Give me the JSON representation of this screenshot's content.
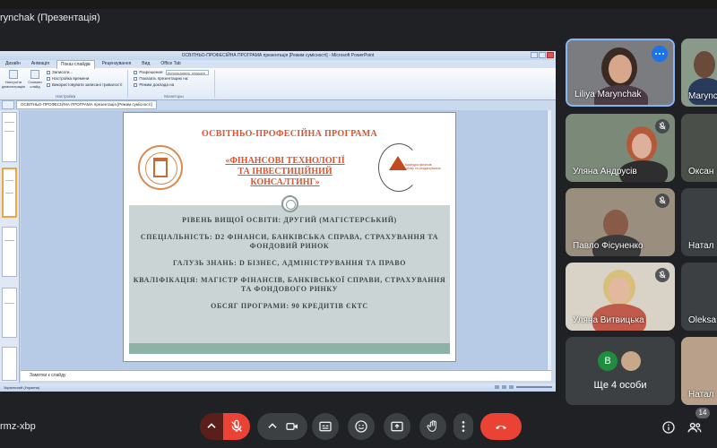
{
  "meet": {
    "presenter_title": "rynchak (Презентація)",
    "meeting_code": "rmz-xbp",
    "participant_count": "14"
  },
  "ppt": {
    "window_title": "ОСВІТНЬО-ПРОФЕСІЙНА ПРОГРАМА презентація [Режим сумісності] - Microsoft PowerPoint",
    "tabs": [
      "Дизайн",
      "Анімація",
      "Показ слайдів",
      "Рецензування",
      "Вид",
      "Office Tab"
    ],
    "ribbon": {
      "group1_btn1": "Настроїти демонстрацію",
      "group1_btn2": "Сховати слайд",
      "group1_items": [
        "Записати...",
        "Настройка времени",
        "Використовувати записані тривалості"
      ],
      "group1_label": "Настройка",
      "group2_items": [
        "Разрешение:",
        "Показать презентацию на:",
        "Режим доклада на"
      ],
      "group2_dropdown": "Использовать текущее",
      "group2_label": "Мониторы"
    },
    "doc_tab": "ОСВІТНЬО-ПРОФЕСІЙНА ПРОГРАМА презентація [Режим сумісності]",
    "notes_placeholder": "Заметки к слайду",
    "status_text": "Украинский (Украина)"
  },
  "slide": {
    "heading": "ОСВІТНЬО-ПРОФЕСІЙНА ПРОГРАМА",
    "program_name_line1": "«ФІНАНСОВІ ТЕХНОЛОГІЇ",
    "program_name_line2": "ТА ІНВЕСТИЦІЙНИЙ",
    "program_name_line3": "КОНСАЛТИНГ»",
    "logo_right_text": "Кафедра фінансів, обліку та оподаткування",
    "lines": [
      "РІВЕНЬ ВИЩОЇ ОСВІТИ: ДРУГИЙ (МАГІСТЕРСЬКИЙ)",
      "СПЕЦІАЛЬНІСТЬ: D2 ФІНАНСИ, БАНКІВСЬКА СПРАВА, СТРАХУВАННЯ ТА ФОНДОВИЙ РИНОК",
      "ГАЛУЗЬ ЗНАНЬ: D БІЗНЕС, АДМІНІСТРУВАННЯ ТА ПРАВО",
      "КВАЛІФІКАЦІЯ: МАГІСТР ФІНАНСІВ, БАНКІВСЬКОЇ СПРАВИ, СТРАХУВАННЯ ТА ФОНДОВОГО РИНКУ",
      "ОБСЯГ ПРОГРАМИ: 90 КРЕДИТІВ ЄКТС"
    ]
  },
  "participants": [
    {
      "name": "Liliya Marynchak"
    },
    {
      "name": "Marync"
    },
    {
      "name": "Уляна Андрусів"
    },
    {
      "name": "Оксан"
    },
    {
      "name": "Павло Фісуненко"
    },
    {
      "name": "Натал"
    },
    {
      "name": "Уляна Витвицька"
    },
    {
      "name": "Oleksa"
    },
    {
      "name": "Натал"
    }
  ],
  "more_tile": {
    "avatar_letter": "B",
    "label": "Ще 4 особи",
    "avatar_color": "#1e8e3e"
  },
  "colors": {
    "accent": "#8ab4f8",
    "end_call": "#ea4335",
    "slide_orange": "#e0532c"
  },
  "icons": [
    "mic-off-icon",
    "camera-icon",
    "captions-icon",
    "emoji-icon",
    "present-icon",
    "raise-hand-icon",
    "more-options-icon",
    "end-call-icon",
    "info-icon",
    "people-icon"
  ]
}
